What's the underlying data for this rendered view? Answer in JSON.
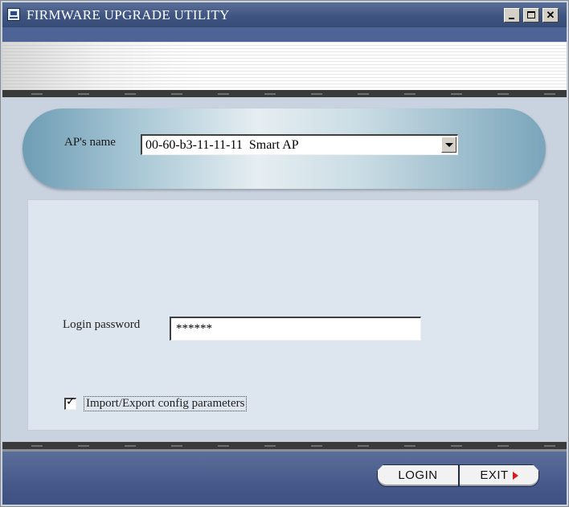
{
  "window": {
    "title": "FIRMWARE UPGRADE UTILITY",
    "controls": {
      "minimize": "_",
      "maximize": "□",
      "close": "✕"
    }
  },
  "ap_section": {
    "label": "AP's name",
    "selected_value": "00-60-b3-11-11-11  Smart AP"
  },
  "login": {
    "password_label": "Login password",
    "password_value": "******"
  },
  "options": {
    "import_export_label": "Import/Export config parameters",
    "import_export_checked": true
  },
  "footer": {
    "login_label": "LOGIN",
    "exit_label": "EXIT"
  },
  "colors": {
    "title_bar": "#3f5581",
    "footer": "#47598a",
    "exit_arrow": "#d81a1a"
  }
}
